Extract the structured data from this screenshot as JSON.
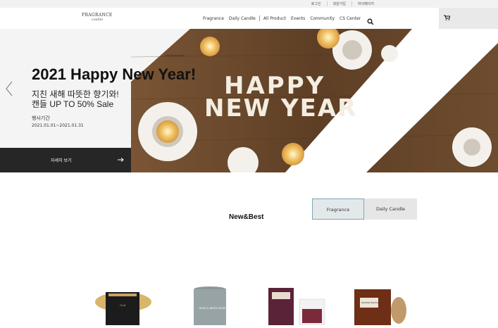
{
  "topbar": {
    "links": [
      "로그인",
      "회원가입",
      "마이페이지"
    ]
  },
  "header": {
    "logo_line1": "FRAGRANCE",
    "logo_line2": "candle",
    "nav": [
      "Fragrance",
      "Daily Candle",
      "All Product",
      "Events",
      "Community",
      "CS Center"
    ],
    "search_icon": "search-icon",
    "cart_icon": "cart-icon"
  },
  "hero": {
    "title": "2021 Happy New Year!",
    "subtitle1": "지친 새해 따뜻한 향기와!",
    "subtitle2": "캔들 UP TO 50% Sale",
    "period_label": "행사기간",
    "period": "2021.01.01~2021.01.31",
    "detail_label": "자세히 보기",
    "image_text": {
      "line1": "HAPPY",
      "line2": "NEW YEAR"
    }
  },
  "section": {
    "title": "New&Best",
    "tabs": [
      "Fragrance",
      "Daily Candle"
    ]
  },
  "products": [
    {
      "label": "Oud"
    },
    {
      "label": "ROSE & WHITE MUSK"
    },
    {
      "label": ""
    },
    {
      "label": "ORANGE BLOSSOM"
    }
  ],
  "colors": {
    "accent": "#7fa5b3",
    "dark": "#262626",
    "wood": "#6b4a2e"
  }
}
